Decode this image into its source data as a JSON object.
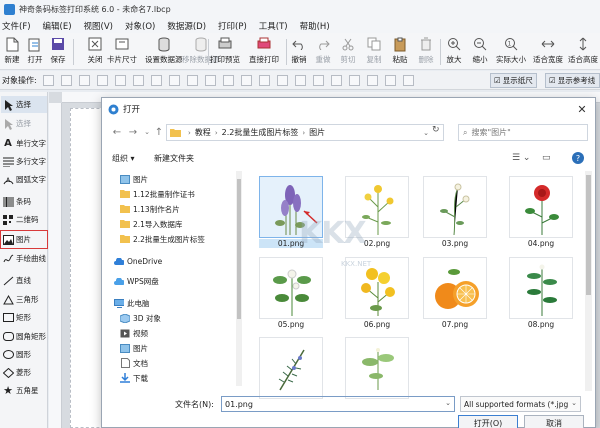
{
  "window": {
    "title": "神奇条码标签打印系统 6.0 - 未命名7.lbcp"
  },
  "menu": [
    "文件(F)",
    "编辑(E)",
    "视图(V)",
    "对象(O)",
    "数据源(D)",
    "打印(P)",
    "工具(T)",
    "帮助(H)"
  ],
  "toolbar": [
    "新建",
    "打开",
    "保存",
    "关闭",
    "卡片尺寸",
    "设置数据源",
    "移除数据源",
    "打印预览",
    "直接打印",
    "撤销",
    "重做",
    "剪切",
    "复制",
    "粘贴",
    "删除",
    "放大",
    "缩小",
    "实际大小",
    "适合宽度",
    "适合高度"
  ],
  "toolbar2": {
    "label": "对象操作:",
    "btn_display": "显示纸尺",
    "btn_ref": "显示参考线"
  },
  "tools": [
    "选择",
    "选择",
    "单行文字",
    "多行文字",
    "圆弧文字",
    "条码",
    "二维码",
    "图片",
    "手绘曲线",
    "直线",
    "三角形",
    "矩形",
    "圆角矩形",
    "圆形",
    "菱形",
    "五角星"
  ],
  "dialog": {
    "title": "打开",
    "breadcrumb": [
      "教程",
      "2.2批量生成图片标签",
      "图片"
    ],
    "search_placeholder": "搜索\"图片\"",
    "organize": "组织 ▾",
    "new_folder": "新建文件夹",
    "tree": [
      "图片",
      "1.12批量制作证书",
      "1.13制作名片",
      "2.1导入数据库",
      "2.2批量生成图片标签",
      "OneDrive",
      "WPS网盘",
      "此电脑",
      "3D 对象",
      "视频",
      "图片",
      "文档",
      "下载"
    ],
    "files": [
      "01.png",
      "02.png",
      "03.png",
      "04.png",
      "05.png",
      "06.png",
      "07.png",
      "08.png",
      "",
      ""
    ],
    "filename_label": "文件名(N):",
    "filename_value": "01.png",
    "filetype": "All supported formats (*.jpg",
    "open_btn": "打开(O)",
    "cancel_btn": "取消"
  },
  "watermark": "KKX",
  "watermark_sub": "KKX.NET"
}
